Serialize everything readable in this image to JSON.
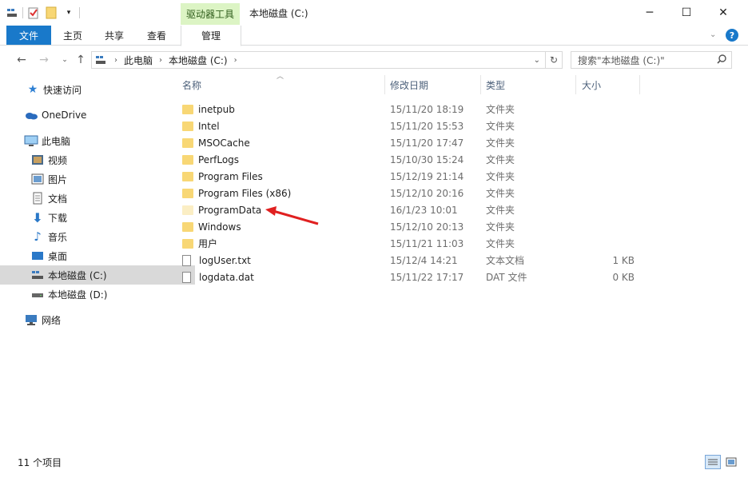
{
  "titlebar": {
    "context_tab": "驱动器工具",
    "title": "本地磁盘 (C:)",
    "minimize": "─",
    "maximize": "☐",
    "close": "✕"
  },
  "ribbon": {
    "tabs": [
      "文件",
      "主页",
      "共享",
      "查看",
      "管理"
    ]
  },
  "address": {
    "path": [
      "此电脑",
      "本地磁盘 (C:)"
    ],
    "search_placeholder": "搜索\"本地磁盘 (C:)\""
  },
  "nav": [
    {
      "label": "快速访问",
      "icon": "star-icon"
    },
    {
      "label": "OneDrive",
      "icon": "cloud-icon"
    },
    {
      "label": "此电脑",
      "icon": "computer-icon"
    },
    {
      "label": "视频",
      "icon": "video-icon"
    },
    {
      "label": "图片",
      "icon": "picture-icon"
    },
    {
      "label": "文档",
      "icon": "document-icon"
    },
    {
      "label": "下载",
      "icon": "download-icon"
    },
    {
      "label": "音乐",
      "icon": "music-icon"
    },
    {
      "label": "桌面",
      "icon": "desktop-icon"
    },
    {
      "label": "本地磁盘 (C:)",
      "icon": "drive-icon"
    },
    {
      "label": "本地磁盘 (D:)",
      "icon": "drive-icon"
    },
    {
      "label": "网络",
      "icon": "network-icon"
    }
  ],
  "columns": {
    "name": "名称",
    "date": "修改日期",
    "type": "类型",
    "size": "大小"
  },
  "files": [
    {
      "name": "inetpub",
      "date": "15/11/20 18:19",
      "type": "文件夹",
      "size": "",
      "kind": "folder"
    },
    {
      "name": "Intel",
      "date": "15/11/20 15:53",
      "type": "文件夹",
      "size": "",
      "kind": "folder"
    },
    {
      "name": "MSOCache",
      "date": "15/11/20 17:47",
      "type": "文件夹",
      "size": "",
      "kind": "folder"
    },
    {
      "name": "PerfLogs",
      "date": "15/10/30 15:24",
      "type": "文件夹",
      "size": "",
      "kind": "folder"
    },
    {
      "name": "Program Files",
      "date": "15/12/19 21:14",
      "type": "文件夹",
      "size": "",
      "kind": "folder"
    },
    {
      "name": "Program Files (x86)",
      "date": "15/12/10 20:16",
      "type": "文件夹",
      "size": "",
      "kind": "folder"
    },
    {
      "name": "ProgramData",
      "date": "16/1/23 10:01",
      "type": "文件夹",
      "size": "",
      "kind": "folder-hidden"
    },
    {
      "name": "Windows",
      "date": "15/12/10 20:13",
      "type": "文件夹",
      "size": "",
      "kind": "folder"
    },
    {
      "name": "用户",
      "date": "15/11/21 11:03",
      "type": "文件夹",
      "size": "",
      "kind": "folder"
    },
    {
      "name": "logUser.txt",
      "date": "15/12/4 14:21",
      "type": "文本文档",
      "size": "1 KB",
      "kind": "file"
    },
    {
      "name": "logdata.dat",
      "date": "15/11/22 17:17",
      "type": "DAT 文件",
      "size": "0 KB",
      "kind": "file"
    }
  ],
  "status": {
    "count": "11 个项目"
  },
  "colors": {
    "accent": "#1979ca",
    "context_tab": "#dcf4c4",
    "selection": "#d9d9d9",
    "annotation": "#e02020"
  }
}
